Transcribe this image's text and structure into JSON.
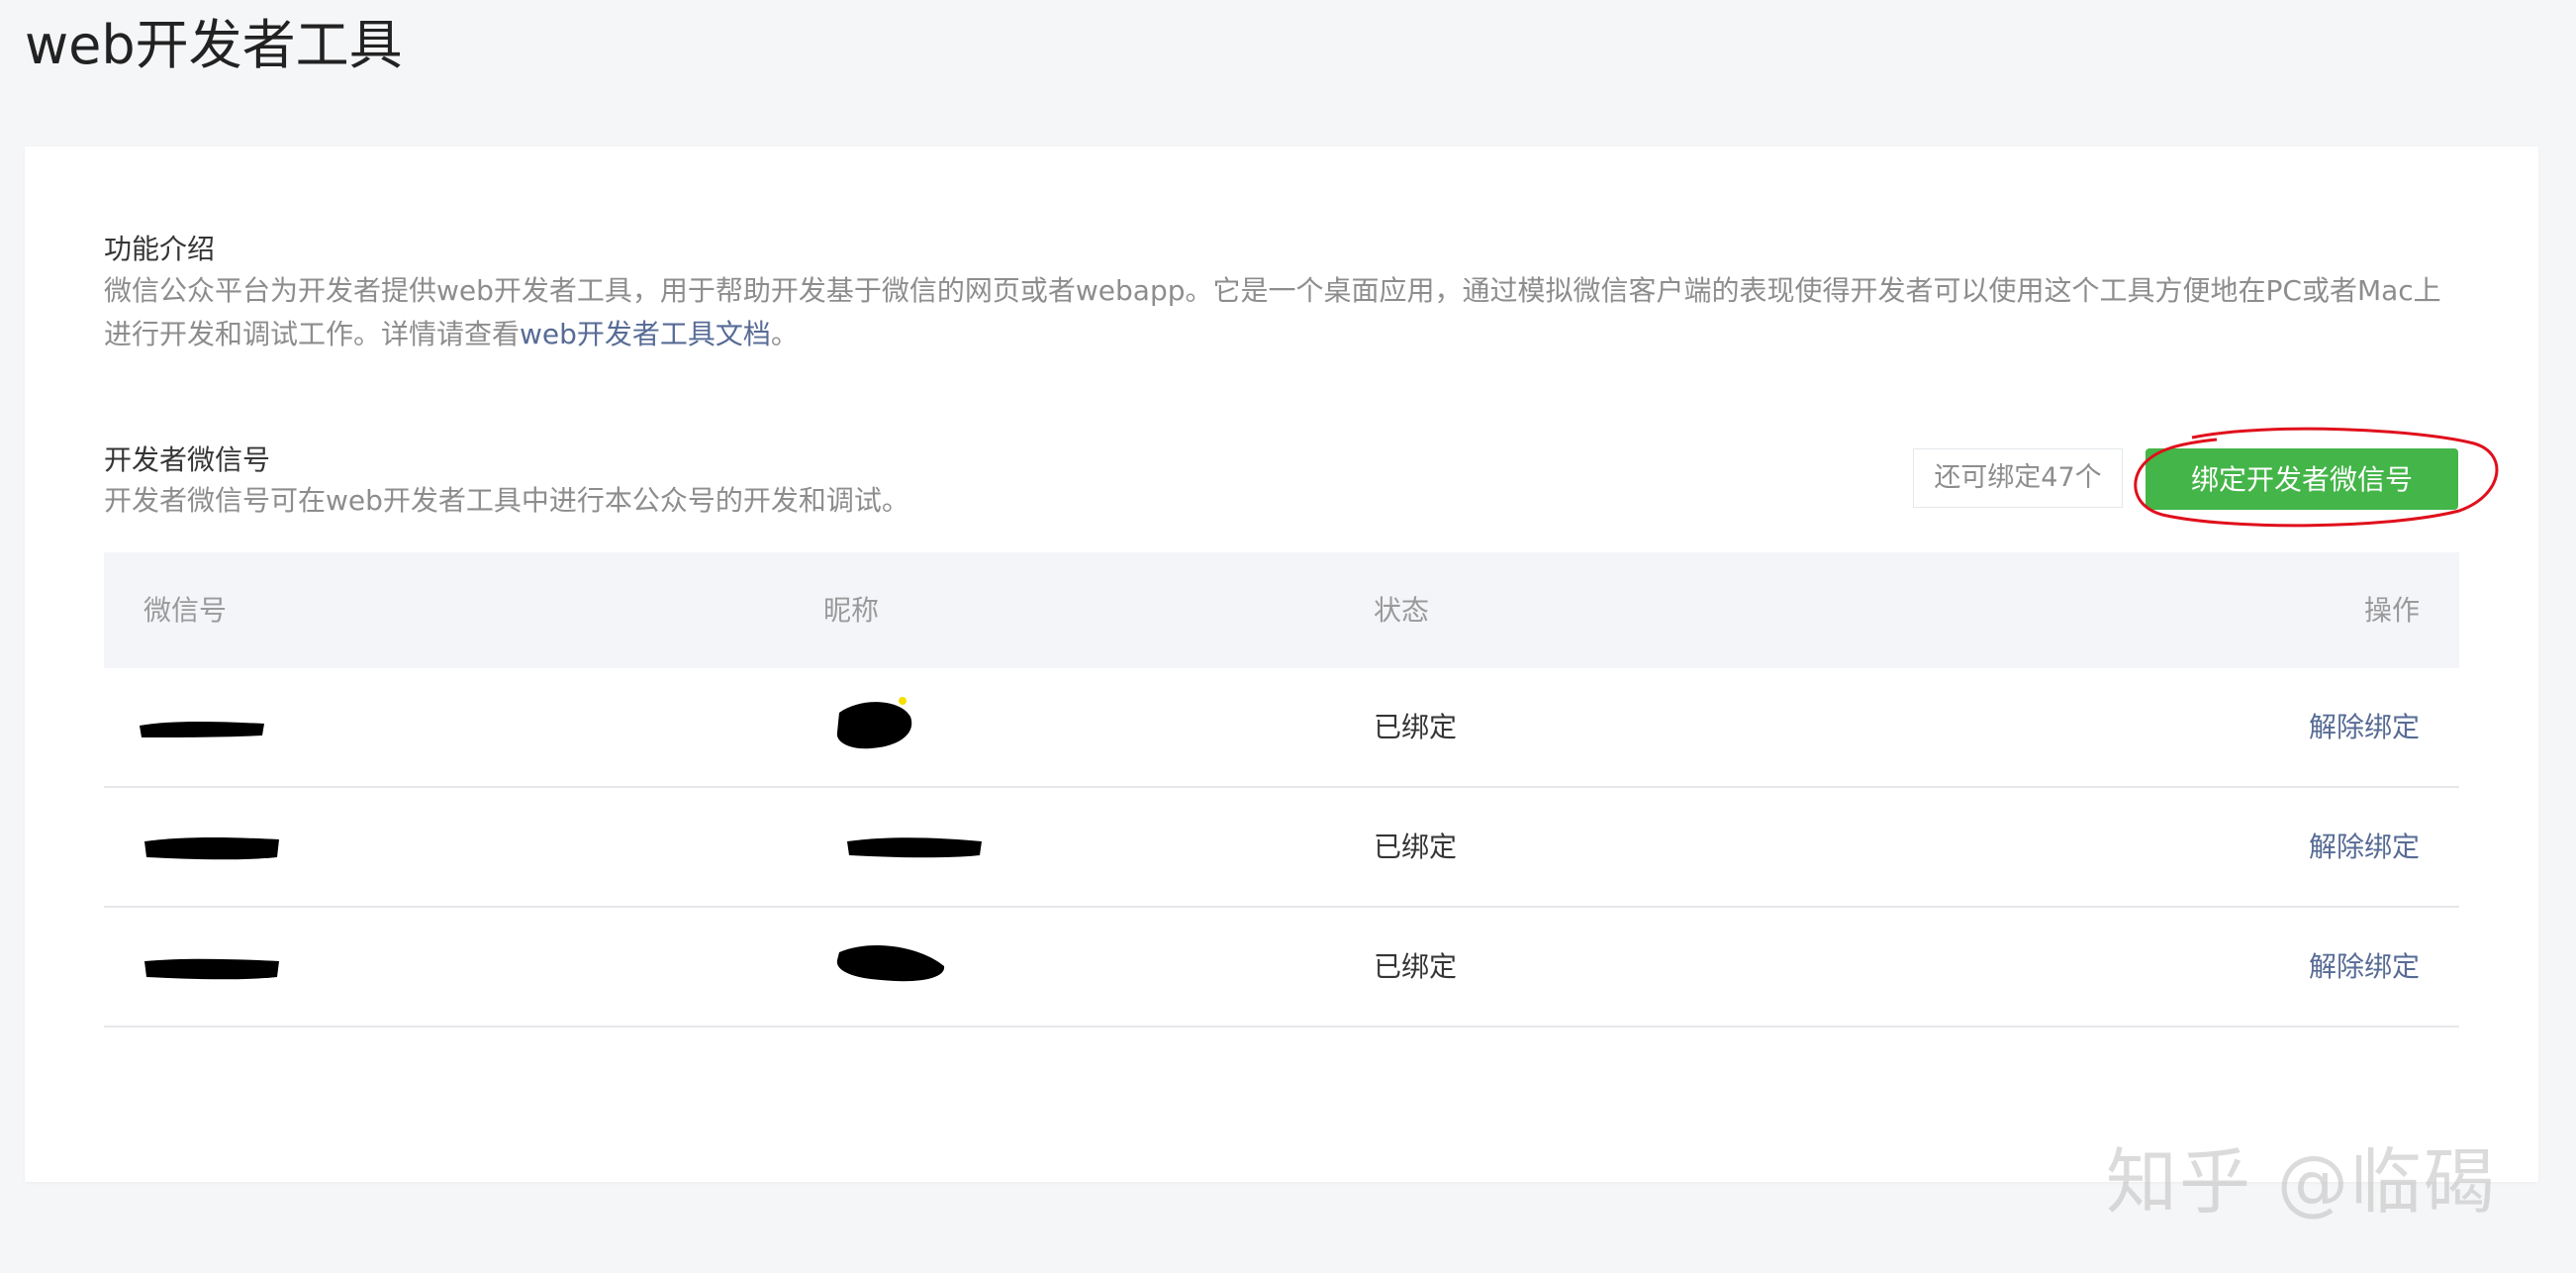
{
  "page": {
    "title": "web开发者工具"
  },
  "intro": {
    "title": "功能介绍",
    "desc_line1": "微信公众平台为开发者提供web开发者工具，用于帮助开发基于微信的网页或者webapp。它是一个桌面应用，通过模拟微信客户端的表现使得开发者可以使用这个工具方便地在PC或者Mac上",
    "desc_line2_pre": "进行开发和调试工作。详情请查看",
    "doc_link": "web开发者工具文档",
    "desc_line2_post": "。"
  },
  "developers": {
    "title": "开发者微信号",
    "desc": "开发者微信号可在web开发者工具中进行本公众号的开发和调试。",
    "quota": "还可绑定47个",
    "bind_button": "绑定开发者微信号"
  },
  "table": {
    "headers": {
      "wechat_id": "微信号",
      "nickname": "昵称",
      "status": "状态",
      "action": "操作"
    },
    "rows": [
      {
        "status": "已绑定",
        "action": "解除绑定"
      },
      {
        "status": "已绑定",
        "action": "解除绑定"
      },
      {
        "status": "已绑定",
        "action": "解除绑定"
      }
    ]
  },
  "watermark": "知乎 @临碣",
  "colors": {
    "primary_green": "#44b549",
    "link_blue": "#576b95",
    "annotation_red": "#e0101c"
  }
}
